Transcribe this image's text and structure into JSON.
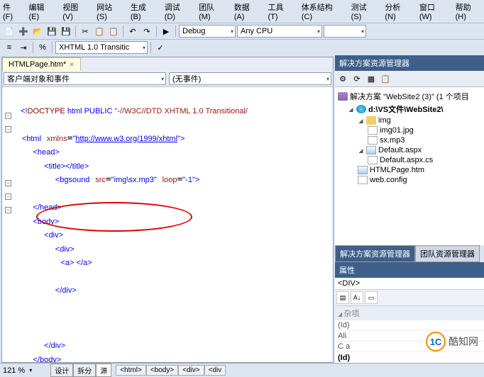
{
  "menubar": [
    "件(F)",
    "编辑(E)",
    "视图(V)",
    "网站(S)",
    "生成(B)",
    "调试(D)",
    "团队(M)",
    "数据(A)",
    "工具(T)",
    "体系结构(C)",
    "测试(S)",
    "分析(N)",
    "窗口(W)",
    "帮助(H)"
  ],
  "toolbar2": {
    "config": "Debug",
    "platform": "Any CPU"
  },
  "toolbar3": {
    "doctype": "XHTML 1.0 Transitic"
  },
  "tab": {
    "name": "HTMLPage.htm*"
  },
  "dropdowns": {
    "left": "客户端对象和事件",
    "right": "(无事件)"
  },
  "code_lines": [
    "  <!DOCTYPE html PUBLIC \"-//W3C//DTD XHTML 1.0 Transitional/",
    "",
    " <html xmlns=\"http://www.w3.org/1999/xhtml\">",
    "   <head>",
    "     <title></title>",
    "       <bgsound src=\"img\\sx.mp3\" loop=\"-1\">",
    "",
    "   </head>",
    "   <body>",
    "     <div>",
    "       <div>",
    "        <a> </a>",
    "",
    "       </div>",
    "",
    "",
    "",
    "     </div>",
    "   </body>",
    " </html>"
  ],
  "solution_explorer": {
    "title": "解决方案资源管理器",
    "root": "解决方案 \"WebSite2 (3)\" (1 个项目",
    "project": "d:\\VS文件\\WebSite2\\",
    "folder": "img",
    "files_img": [
      "img01.jpg",
      "sx.mp3"
    ],
    "default": "Default.aspx",
    "default_cs": "Default.aspx.cs",
    "htmlpage": "HTMLPage.htm",
    "webconfig": "web.config",
    "bottom_tabs": [
      "解决方案资源管理器",
      "团队资源管理器"
    ]
  },
  "properties": {
    "title": "属性",
    "object": "<DIV>",
    "category": "杂项",
    "rows": [
      "(Id)",
      "Ali",
      "C a"
    ],
    "footer": "(Id)"
  },
  "status": {
    "zoom": "121 %",
    "tabs": [
      "设计",
      "拆分",
      "源"
    ],
    "crumbs": [
      "<html>",
      "<body>",
      "<div>",
      "<div"
    ]
  },
  "watermark": "酷知网"
}
